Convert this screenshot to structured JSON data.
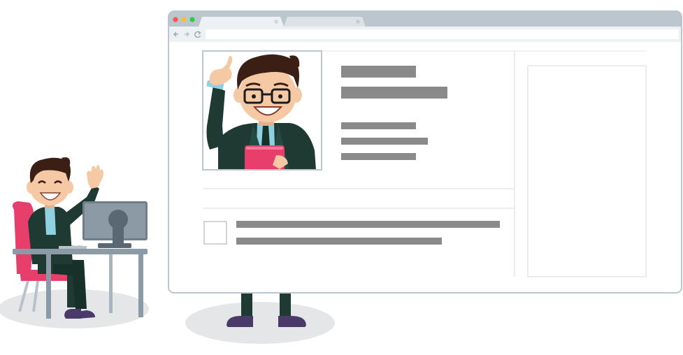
{
  "browser": {
    "tabs": [
      {
        "label": ""
      },
      {
        "label": ""
      }
    ],
    "address_bar": {
      "value": ""
    },
    "nav_icons": [
      "back-arrow-icon",
      "forward-arrow-icon",
      "reload-icon"
    ],
    "window_controls": [
      "#f05a52",
      "#f6bd3c",
      "#33c748"
    ]
  },
  "colors": {
    "frame": "#bcc6ce",
    "chrome_bar": "#eef1f3",
    "placeholder": "#8a8a8a",
    "divider": "#e6e6e6",
    "suit": "#1e3a32",
    "shirt": "#8fd1e0",
    "skin": "#f6c9a5",
    "hair": "#3b1f14",
    "chair": "#e83e6b",
    "tablet": "#e83e6b",
    "shoes": "#4a3a6a",
    "shadow": "#e4e6e8"
  }
}
